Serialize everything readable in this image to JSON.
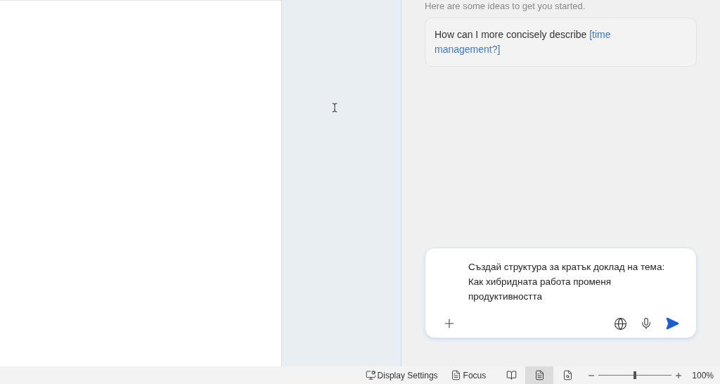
{
  "chat": {
    "intro": "Here are some ideas to get you started.",
    "suggestion": {
      "text": "How can I more concisely describe ",
      "highlight": "[time management?]"
    },
    "prompt": {
      "value": "Създай структура за кратък доклад на тема: Как хибридната работа променя продуктивността"
    }
  },
  "status_bar": {
    "display_settings": "Display Settings",
    "focus": "Focus",
    "views": [
      {
        "kind": "read",
        "selected": false
      },
      {
        "kind": "print",
        "selected": true
      },
      {
        "kind": "web",
        "selected": false
      }
    ],
    "zoom": {
      "level": 0.5,
      "reading": "100%"
    }
  }
}
